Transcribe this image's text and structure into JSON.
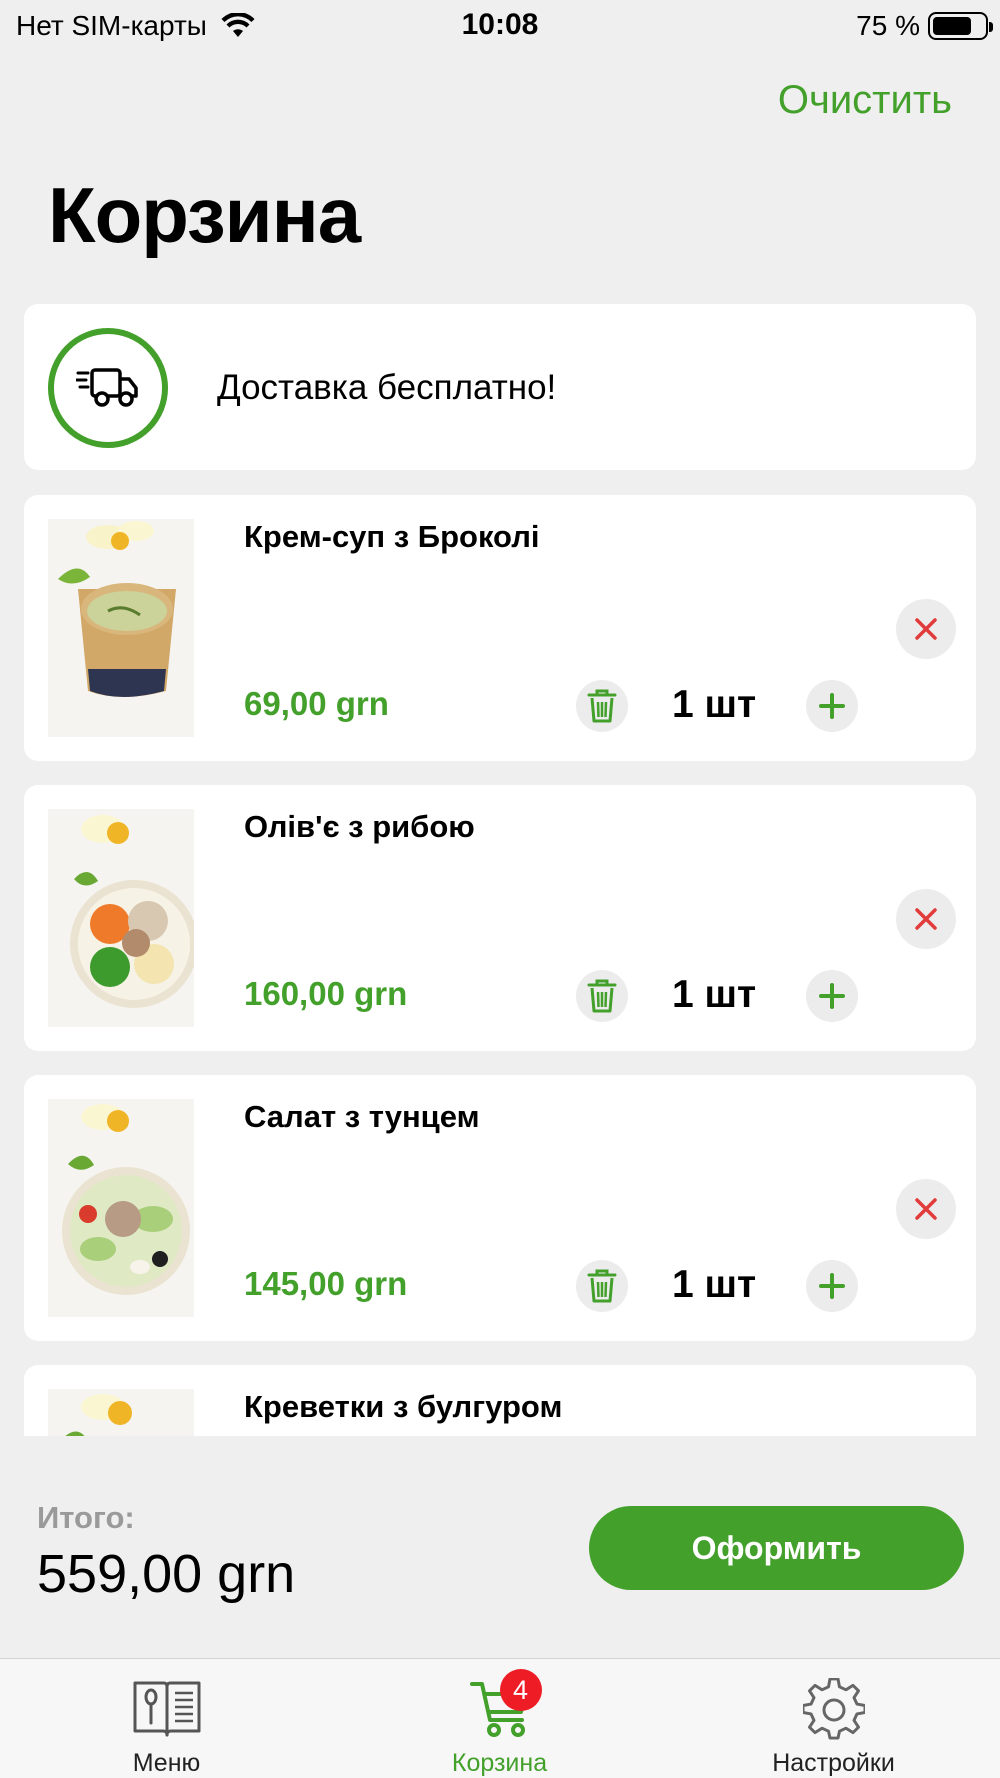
{
  "status_bar": {
    "carrier": "Нет SIM-карты",
    "time": "10:08",
    "battery": "75 %",
    "battery_level": 0.75
  },
  "header": {
    "clear_label": "Очистить",
    "title": "Корзина"
  },
  "delivery": {
    "text": "Доставка бесплатно!",
    "icon": "truck-icon"
  },
  "cart_items": [
    {
      "name": "Крем-суп з Броколі",
      "price": "69,00 grn",
      "quantity": "1 шт",
      "image": "soup-photo"
    },
    {
      "name": "Олів'є з рибою",
      "price": "160,00 grn",
      "quantity": "1 шт",
      "image": "salad-photo"
    },
    {
      "name": "Салат з тунцем",
      "price": "145,00 grn",
      "quantity": "1 шт",
      "image": "tuna-salad-photo"
    },
    {
      "name": "Креветки з булгуром",
      "price": "",
      "quantity": "",
      "image": "shrimp-bulgur-photo"
    }
  ],
  "total": {
    "label": "Итого:",
    "value": "559,00 grn"
  },
  "checkout": {
    "label": "Оформить"
  },
  "tab_bar": {
    "tabs": [
      {
        "label": "Меню",
        "icon": "menu-book-icon"
      },
      {
        "label": "Корзина",
        "icon": "cart-icon",
        "badge": "4"
      },
      {
        "label": "Настройки",
        "icon": "gear-icon"
      }
    ]
  },
  "colors": {
    "accent": "#43a02b",
    "badge": "#ee1c24",
    "remove": "#e23b3b"
  }
}
